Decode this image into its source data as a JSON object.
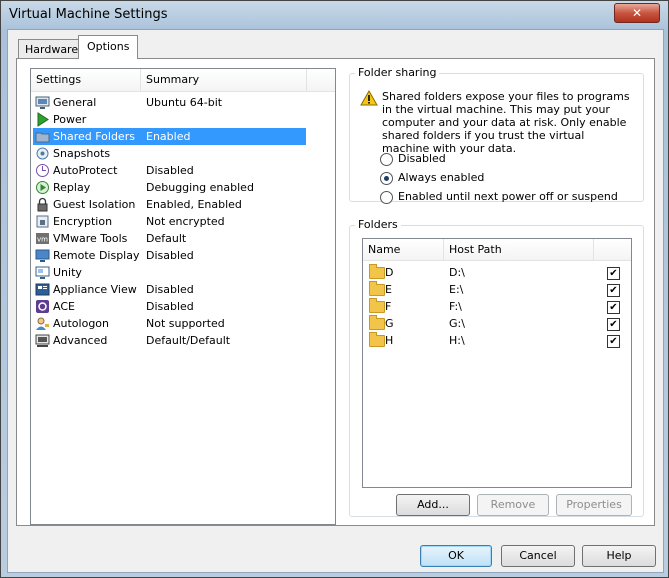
{
  "window": {
    "title": "Virtual Machine Settings",
    "close_glyph": "✕"
  },
  "tabs": [
    {
      "label": "Hardware"
    },
    {
      "label": "Options"
    }
  ],
  "settings": {
    "headers": {
      "settings": "Settings",
      "summary": "Summary"
    },
    "items": [
      {
        "name": "General",
        "summary": "Ubuntu 64-bit",
        "icon": "general-icon"
      },
      {
        "name": "Power",
        "summary": "",
        "icon": "power-icon"
      },
      {
        "name": "Shared Folders",
        "summary": "Enabled",
        "icon": "shared-folders-icon",
        "selected": true
      },
      {
        "name": "Snapshots",
        "summary": "",
        "icon": "snapshots-icon"
      },
      {
        "name": "AutoProtect",
        "summary": "Disabled",
        "icon": "autoprotect-icon"
      },
      {
        "name": "Replay",
        "summary": "Debugging enabled",
        "icon": "replay-icon"
      },
      {
        "name": "Guest Isolation",
        "summary": "Enabled, Enabled",
        "icon": "lock-icon"
      },
      {
        "name": "Encryption",
        "summary": "Not encrypted",
        "icon": "encryption-icon"
      },
      {
        "name": "VMware Tools",
        "summary": "Default",
        "icon": "vmware-tools-icon"
      },
      {
        "name": "Remote Display",
        "summary": "Disabled",
        "icon": "remote-display-icon"
      },
      {
        "name": "Unity",
        "summary": "",
        "icon": "unity-icon"
      },
      {
        "name": "Appliance View",
        "summary": "Disabled",
        "icon": "appliance-view-icon"
      },
      {
        "name": "ACE",
        "summary": "Disabled",
        "icon": "ace-icon"
      },
      {
        "name": "Autologon",
        "summary": "Not supported",
        "icon": "autologon-icon"
      },
      {
        "name": "Advanced",
        "summary": "Default/Default",
        "icon": "advanced-icon"
      }
    ]
  },
  "folder_sharing": {
    "label": "Folder sharing",
    "warning": "Shared folders expose your files to programs in the virtual machine. This may put your computer and your data at risk. Only enable shared folders if you trust the virtual machine with your data.",
    "options": [
      {
        "label": "Disabled",
        "checked": false
      },
      {
        "label": "Always enabled",
        "checked": true
      },
      {
        "label": "Enabled until next power off or suspend",
        "checked": false
      }
    ]
  },
  "folders": {
    "label": "Folders",
    "headers": {
      "name": "Name",
      "host_path": "Host Path"
    },
    "rows": [
      {
        "name": "D",
        "path": "D:\\",
        "checked": true
      },
      {
        "name": "E",
        "path": "E:\\",
        "checked": true
      },
      {
        "name": "F",
        "path": "F:\\",
        "checked": true
      },
      {
        "name": "G",
        "path": "G:\\",
        "checked": true
      },
      {
        "name": "H",
        "path": "H:\\",
        "checked": true
      }
    ],
    "buttons": {
      "add": "Add...",
      "remove": "Remove",
      "properties": "Properties"
    }
  },
  "dialog_buttons": {
    "ok": "OK",
    "cancel": "Cancel",
    "help": "Help"
  },
  "colors": {
    "selection": "#3399ff",
    "folder": "#f3c44a",
    "warning": "#f5c518"
  }
}
